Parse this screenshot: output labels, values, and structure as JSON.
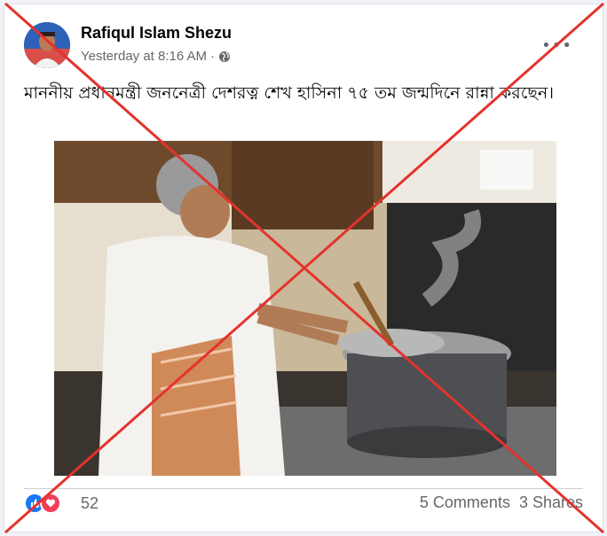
{
  "post": {
    "author_name": "Rafiqul Islam Shezu",
    "timestamp": "Yesterday at 8:16 AM",
    "separator": "·",
    "privacy_icon": "globe-icon",
    "more_icon": "more-options-icon",
    "more_glyph": "•••",
    "text": "মাননীয় প্রধানমন্ত্রী জননেত্রী দেশরত্ন শেখ হাসিনা ৭৫ তম জন্মদিনে রান্না করছেন।"
  },
  "engagement": {
    "reaction_icons": [
      "like-icon",
      "love-icon"
    ],
    "reaction_count": "52",
    "comments": "5 Comments",
    "shares": "3 Shares"
  },
  "overlay": {
    "mark": "red-x-cross",
    "color": "#e5322d"
  }
}
